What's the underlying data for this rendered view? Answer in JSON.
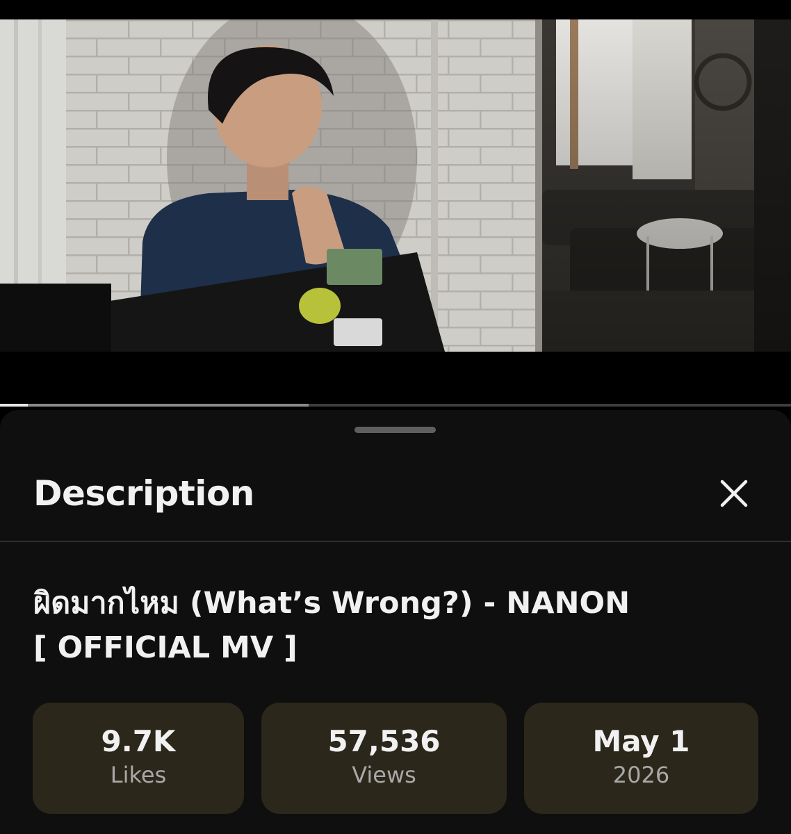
{
  "player": {
    "progress": {
      "played": 0.035,
      "buffered": 0.39
    }
  },
  "sheet": {
    "title": "Description",
    "close_icon": "close-icon"
  },
  "video": {
    "title_line1": "ผิดมากไหม (What’s Wrong?) - NANON",
    "title_line2": "[ OFFICIAL MV ]"
  },
  "stats": [
    {
      "value": "9.7K",
      "label": "Likes"
    },
    {
      "value": "57,536",
      "label": "Views"
    },
    {
      "value": "May 1",
      "label": "2026"
    }
  ],
  "colors": {
    "sheet_bg": "#0f0f0f",
    "stat_bg": "#2c271b",
    "text_primary": "#f1f1f1",
    "text_secondary": "#a8a8a8"
  }
}
